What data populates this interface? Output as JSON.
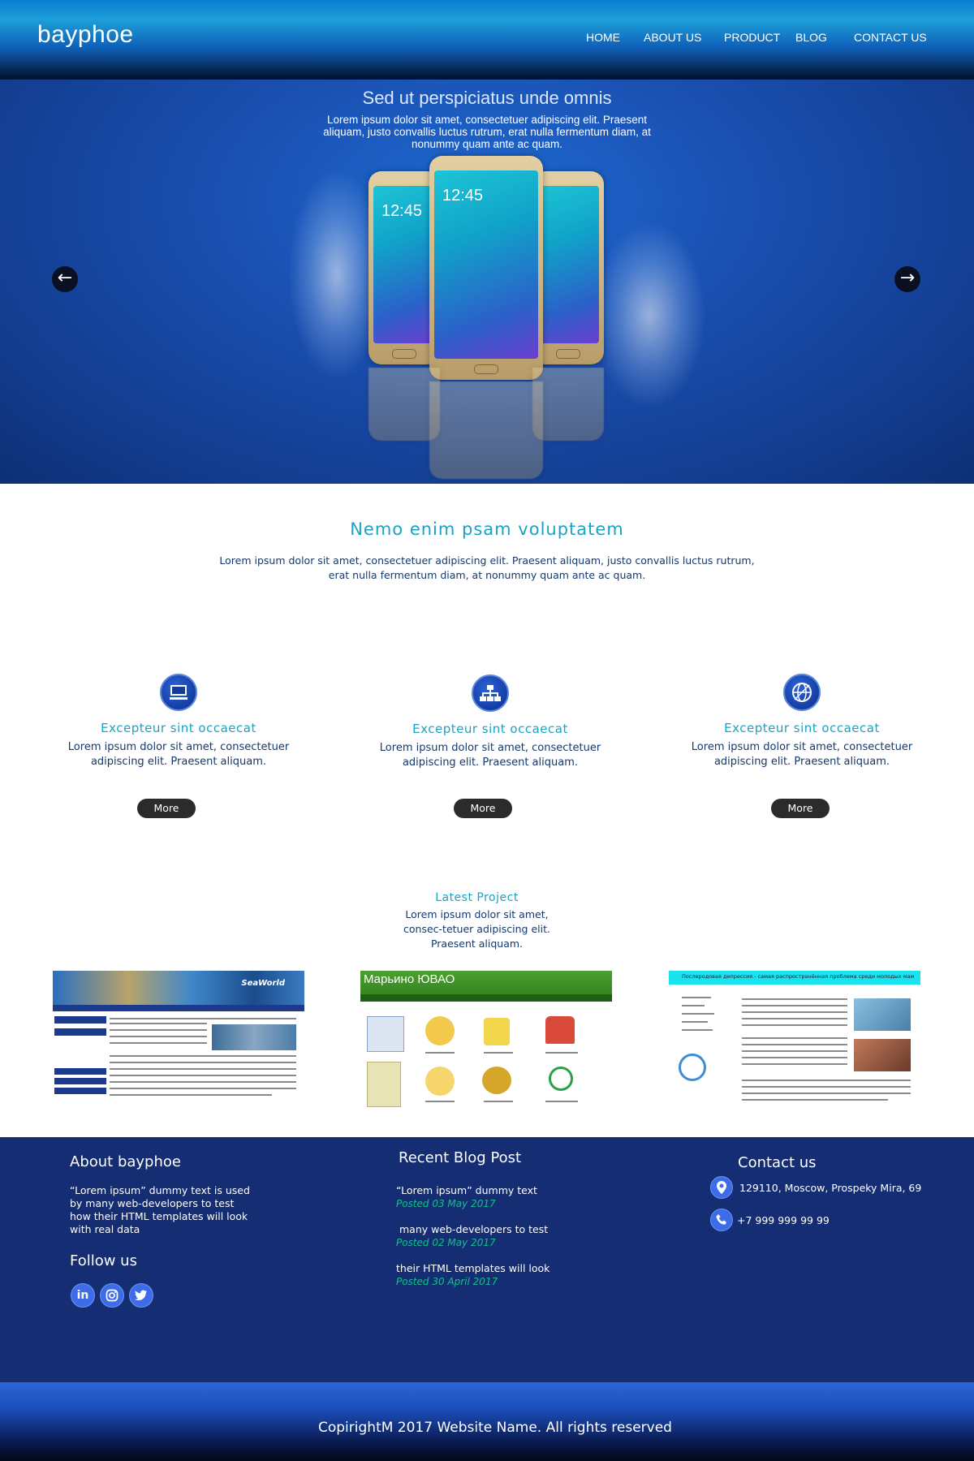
{
  "header": {
    "logo": "bayphoe",
    "nav": [
      "HOME",
      "ABOUT US",
      "PRODUCT",
      "BLOG",
      "CONTACT US"
    ]
  },
  "hero": {
    "title": "Sed ut perspiciatus unde omnis",
    "text": "Lorem ipsum dolor sit amet, consectetuer adipiscing elit. Praesent aliquam, justo convallis luctus rutrum, erat nulla fermentum diam, at nonummy quam ante ac quam.",
    "phone_time": "12:45",
    "prev_icon": "arrow-left-icon",
    "next_icon": "arrow-right-icon"
  },
  "intro": {
    "title": "Nemo enim psam voluptatem",
    "text": "Lorem ipsum dolor sit amet, consectetuer adipiscing elit. Praesent aliquam, justo convallis luctus rutrum, erat nulla fermentum diam, at nonummy quam ante ac quam."
  },
  "features": [
    {
      "icon": "computer-icon",
      "title": "Excepteur sint occaecat",
      "text": "Lorem ipsum dolor sit amet, consectetuer adipiscing elit. Praesent aliquam.",
      "button": "More"
    },
    {
      "icon": "network-icon",
      "title": "Excepteur sint occaecat",
      "text": "Lorem ipsum dolor sit amet, consectetuer adipiscing elit. Praesent aliquam.",
      "button": "More"
    },
    {
      "icon": "globe-icon",
      "title": "Excepteur sint occaecat",
      "text": "Lorem ipsum dolor sit amet, consectetuer adipiscing elit. Praesent aliquam.",
      "button": "More"
    }
  ],
  "latest": {
    "title": "Latest Project",
    "text": "Lorem ipsum dolor sit amet, consec-tetuer adipiscing elit. Praesent aliquam.",
    "projects": [
      {
        "banner_text": "SeaWorld"
      },
      {
        "banner_text": "Марьино ЮВАО"
      },
      {
        "banner_text": "Послеродовая депрессия - самая распространённая проблема среди молодых мам"
      }
    ]
  },
  "footer": {
    "about": {
      "title": "About bayphoe",
      "text": "“Lorem ipsum” dummy text is used by many web-developers to test how their HTML templates will look with real data"
    },
    "follow": {
      "title": "Follow us",
      "links": [
        "in",
        "ig",
        "tw"
      ]
    },
    "blog": {
      "title": "Recent Blog Post",
      "posts": [
        {
          "title": "“Lorem ipsum” dummy text",
          "date": "Posted 03 May 2017"
        },
        {
          "title": "many web-developers to test",
          "date": "Posted 02 May 2017"
        },
        {
          "title": "their HTML templates will look",
          "date": "Posted 30 April 2017"
        }
      ]
    },
    "contact": {
      "title": "Contact us",
      "address": "129110, Moscow, Prospeky Mira, 69",
      "phone": "+7 999 999 99 99"
    },
    "copyright": "CopirightM 2017 Website Name. All rights reserved"
  },
  "colors": {
    "accent": "#1aa3c4",
    "footer_bg": "#142d73",
    "date_green": "#14c08a",
    "button_dark": "#2b2b2b"
  }
}
